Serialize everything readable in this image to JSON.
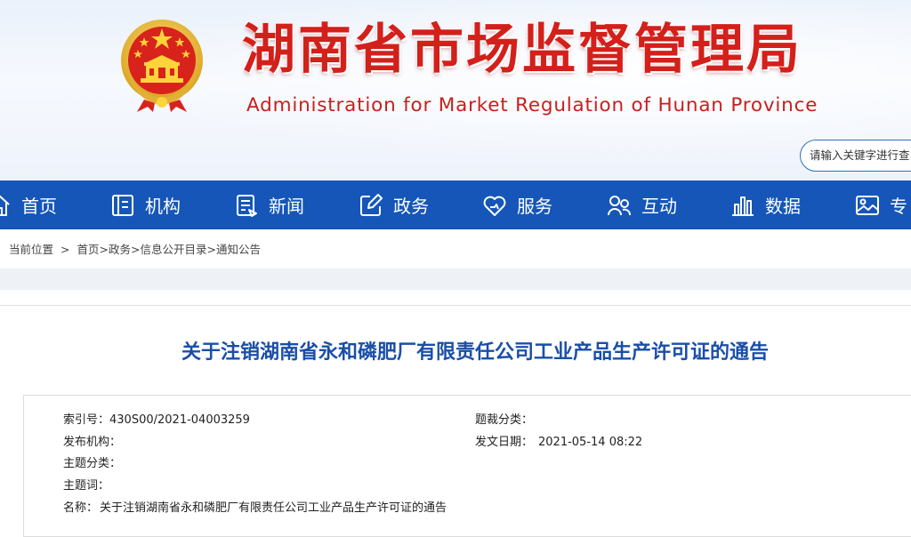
{
  "header": {
    "title": "湖南省市场监督管理局",
    "subtitle": "Administration for Market Regulation of Hunan Province",
    "search_placeholder": "请输入关键字进行查"
  },
  "colors": {
    "brand_red": "#d3201b",
    "nav_blue": "#1656b8",
    "title_blue": "#1a4ea8"
  },
  "nav": {
    "items": [
      {
        "label": "首页",
        "icon": "home-icon"
      },
      {
        "label": "机构",
        "icon": "document-icon"
      },
      {
        "label": "新闻",
        "icon": "news-icon"
      },
      {
        "label": "政务",
        "icon": "edit-icon"
      },
      {
        "label": "服务",
        "icon": "service-icon"
      },
      {
        "label": "互动",
        "icon": "interaction-icon"
      },
      {
        "label": "数据",
        "icon": "bar-chart-icon"
      },
      {
        "label": "专",
        "icon": "image-icon"
      }
    ]
  },
  "breadcrumb": {
    "prefix": "当前位置",
    "sep": ">",
    "items": [
      "首页",
      "政务",
      "信息公开目录",
      "通知公告"
    ],
    "item_sep": ">"
  },
  "article": {
    "title": "关于注销湖南省永和磷肥厂有限责任公司工业产品生产许可证的通告",
    "meta": {
      "index_no": {
        "label": "索引号：",
        "value": "430S00/2021-04003259"
      },
      "category": {
        "label": "题裁分类：",
        "value": ""
      },
      "publisher": {
        "label": "发布机构：",
        "value": ""
      },
      "date": {
        "label": "发文日期：",
        "value": "2021-05-14 08:22"
      },
      "topic": {
        "label": "主题分类：",
        "value": ""
      },
      "keywords": {
        "label": "主题词：",
        "value": ""
      },
      "name": {
        "label": "名称：",
        "value": "关于注销湖南省永和磷肥厂有限责任公司工业产品生产许可证的通告"
      }
    }
  }
}
